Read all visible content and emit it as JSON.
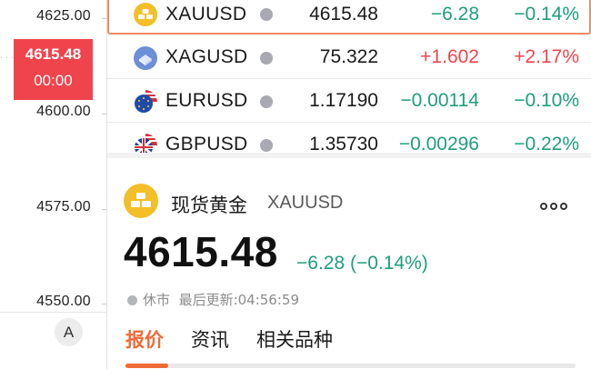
{
  "axis": {
    "labels": [
      "4625.00",
      "4600.00",
      "4575.00",
      "4550.00"
    ],
    "marker_price": "4615.48",
    "marker_time": "00:00",
    "auto_button": "A"
  },
  "watchlist": [
    {
      "symbol": "XAUUSD",
      "price": "4615.48",
      "change": "−6.28",
      "percent": "−0.14%",
      "direction": "down",
      "icon": "gold-bars-icon",
      "selected": true
    },
    {
      "symbol": "XAGUSD",
      "price": "75.322",
      "change": "+1.602",
      "percent": "+2.17%",
      "direction": "up",
      "icon": "silver-bars-icon",
      "selected": false
    },
    {
      "symbol": "EURUSD",
      "price": "1.17190",
      "change": "−0.00114",
      "percent": "−0.10%",
      "direction": "down",
      "icon": "eu-us-flag-icon",
      "selected": false
    },
    {
      "symbol": "GBPUSD",
      "price": "1.35730",
      "change": "−0.00296",
      "percent": "−0.22%",
      "direction": "down",
      "icon": "uk-us-flag-icon",
      "selected": false
    }
  ],
  "detail": {
    "name_cn": "现货黄金",
    "symbol": "XAUUSD",
    "price": "4615.48",
    "change": "−6.28 (−0.14%)",
    "status": "休市",
    "updated": "最后更新:04:56:59",
    "more_icon": "more-dots-icon"
  },
  "tabs": [
    {
      "label": "报价",
      "active": true
    },
    {
      "label": "资讯",
      "active": false
    },
    {
      "label": "相关品种",
      "active": false
    }
  ],
  "colors": {
    "up": "#f0444d",
    "down": "#1f9e7c",
    "accent": "#f16a37",
    "selected_border": "#f28a62",
    "gold": "#f3be27"
  }
}
